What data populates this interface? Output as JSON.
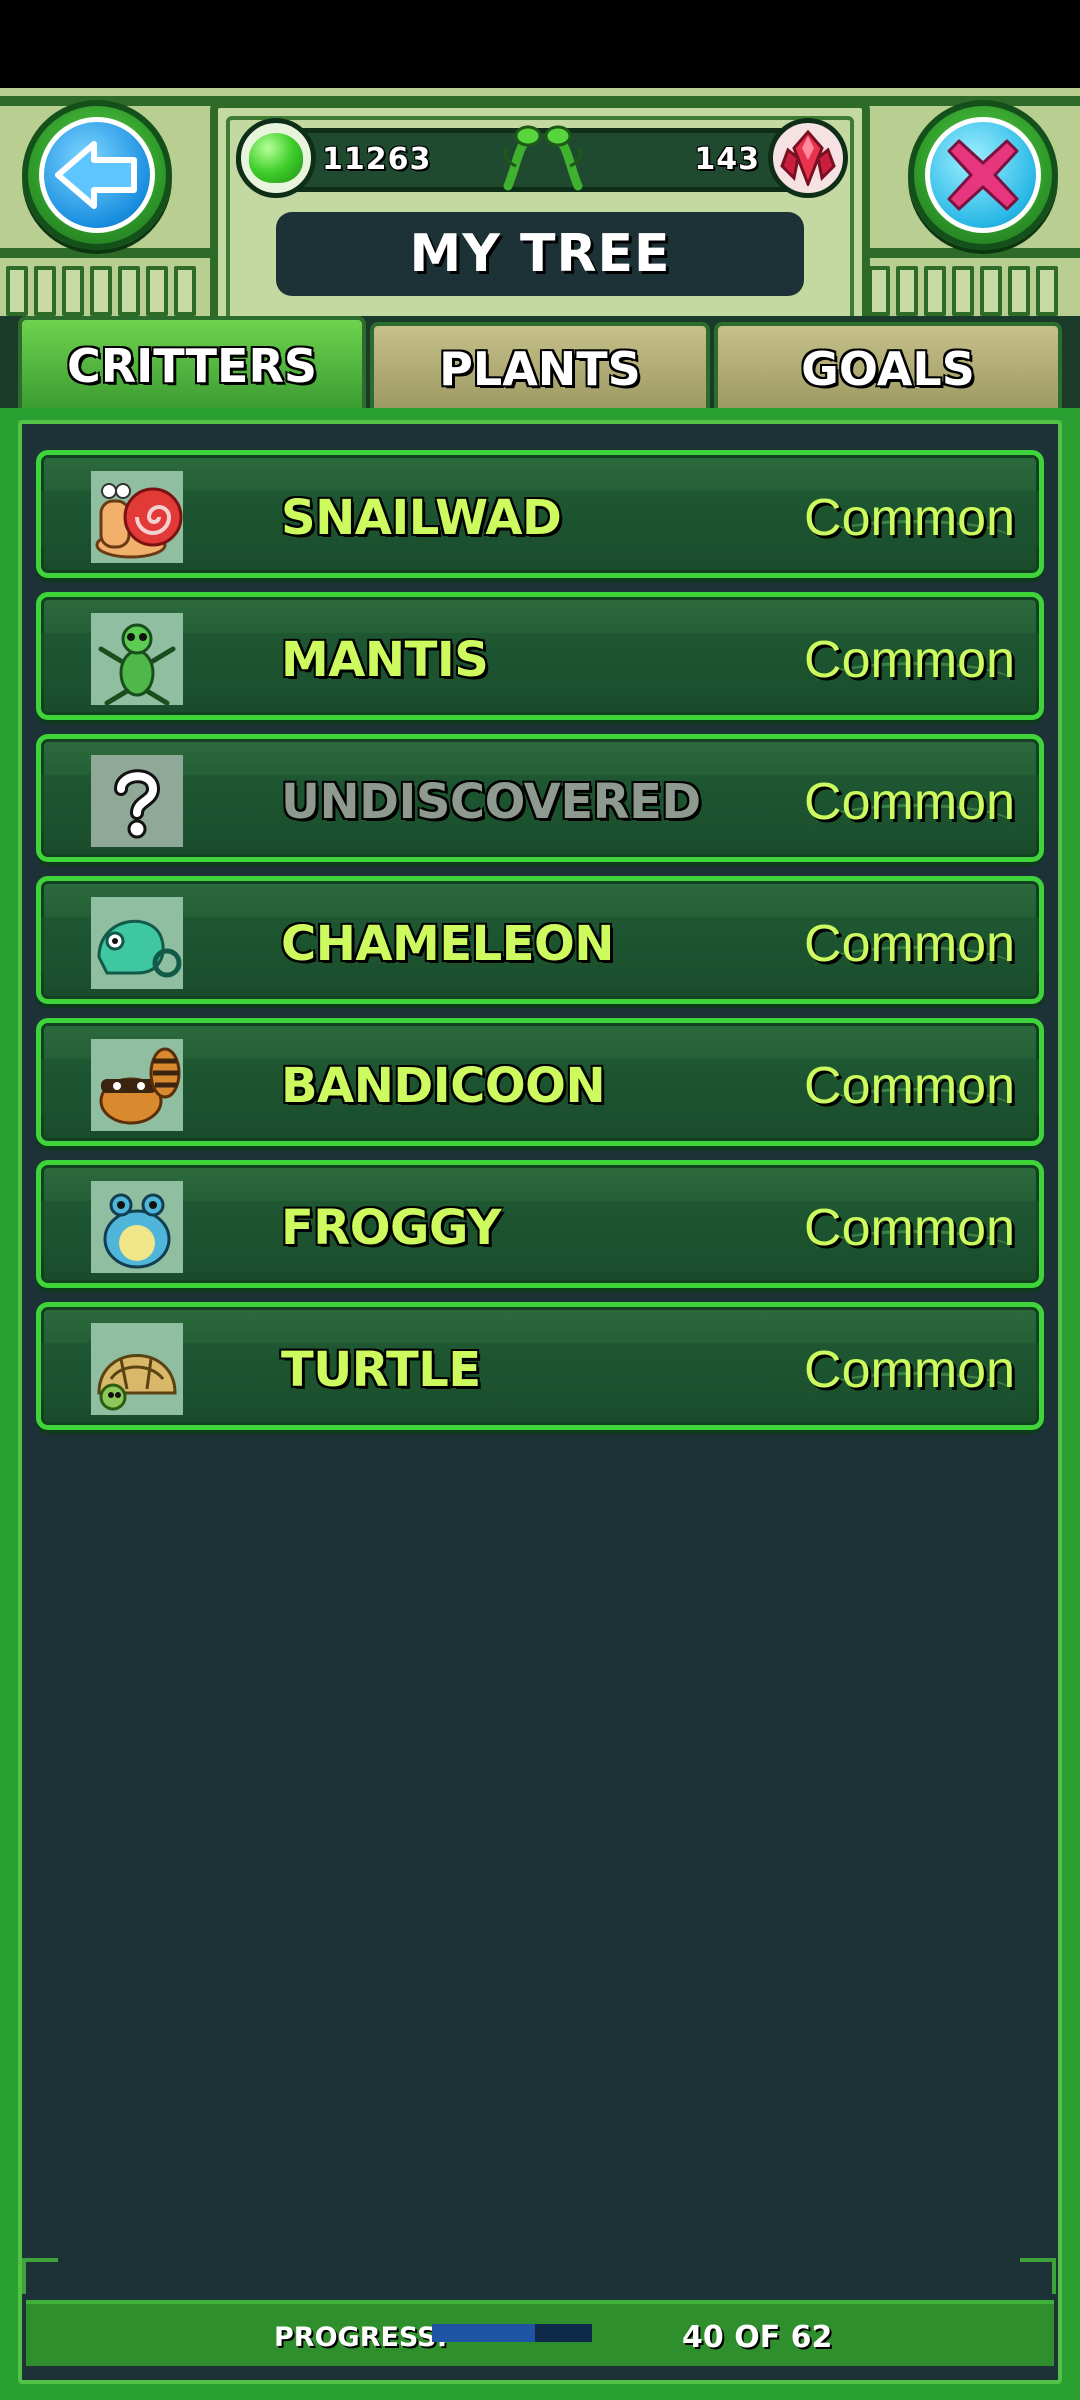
{
  "header": {
    "title": "MY TREE",
    "gems": "11263",
    "crystals": "143"
  },
  "tabs": [
    {
      "label": "CRITTERS",
      "active": true
    },
    {
      "label": "PLANTS",
      "active": false
    },
    {
      "label": "GOALS",
      "active": false
    }
  ],
  "critters": [
    {
      "name": "SNAILWAD",
      "rarity": "Common",
      "icon": "snail-icon",
      "discovered": true
    },
    {
      "name": "MANTIS",
      "rarity": "Common",
      "icon": "mantis-icon",
      "discovered": true
    },
    {
      "name": "UNDISCOVERED",
      "rarity": "Common",
      "icon": "question-mark-icon",
      "discovered": false
    },
    {
      "name": "CHAMELEON",
      "rarity": "Common",
      "icon": "chameleon-icon",
      "discovered": true
    },
    {
      "name": "BANDICOON",
      "rarity": "Common",
      "icon": "raccoon-icon",
      "discovered": true
    },
    {
      "name": "FROGGY",
      "rarity": "Common",
      "icon": "frog-icon",
      "discovered": true
    },
    {
      "name": "TURTLE",
      "rarity": "Common",
      "icon": "turtle-icon",
      "discovered": true
    }
  ],
  "footer": {
    "progress_label": "PROGRESS:",
    "progress_count": "40 OF 62",
    "progress_fraction": 0.645
  },
  "colors": {
    "accent_green": "#3fd43a",
    "name_text": "#cdfb5f",
    "panel_bg": "#1c3237"
  }
}
